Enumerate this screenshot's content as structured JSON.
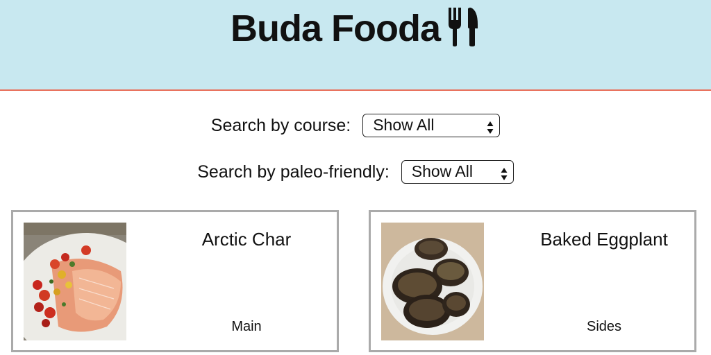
{
  "header": {
    "title": "Buda Fooda",
    "icon": "fork-knife-icon",
    "background": "#c8e8f0",
    "accent_line": "#e8705a"
  },
  "filters": {
    "course": {
      "label": "Search by course:",
      "selected": "Show All"
    },
    "paleo": {
      "label": "Search by paleo-friendly:",
      "selected": "Show All"
    }
  },
  "recipes": [
    {
      "name": "Arctic Char",
      "course": "Main",
      "image": "salmon-photo"
    },
    {
      "name": "Baked Eggplant",
      "course": "Sides",
      "image": "eggplant-photo"
    }
  ]
}
